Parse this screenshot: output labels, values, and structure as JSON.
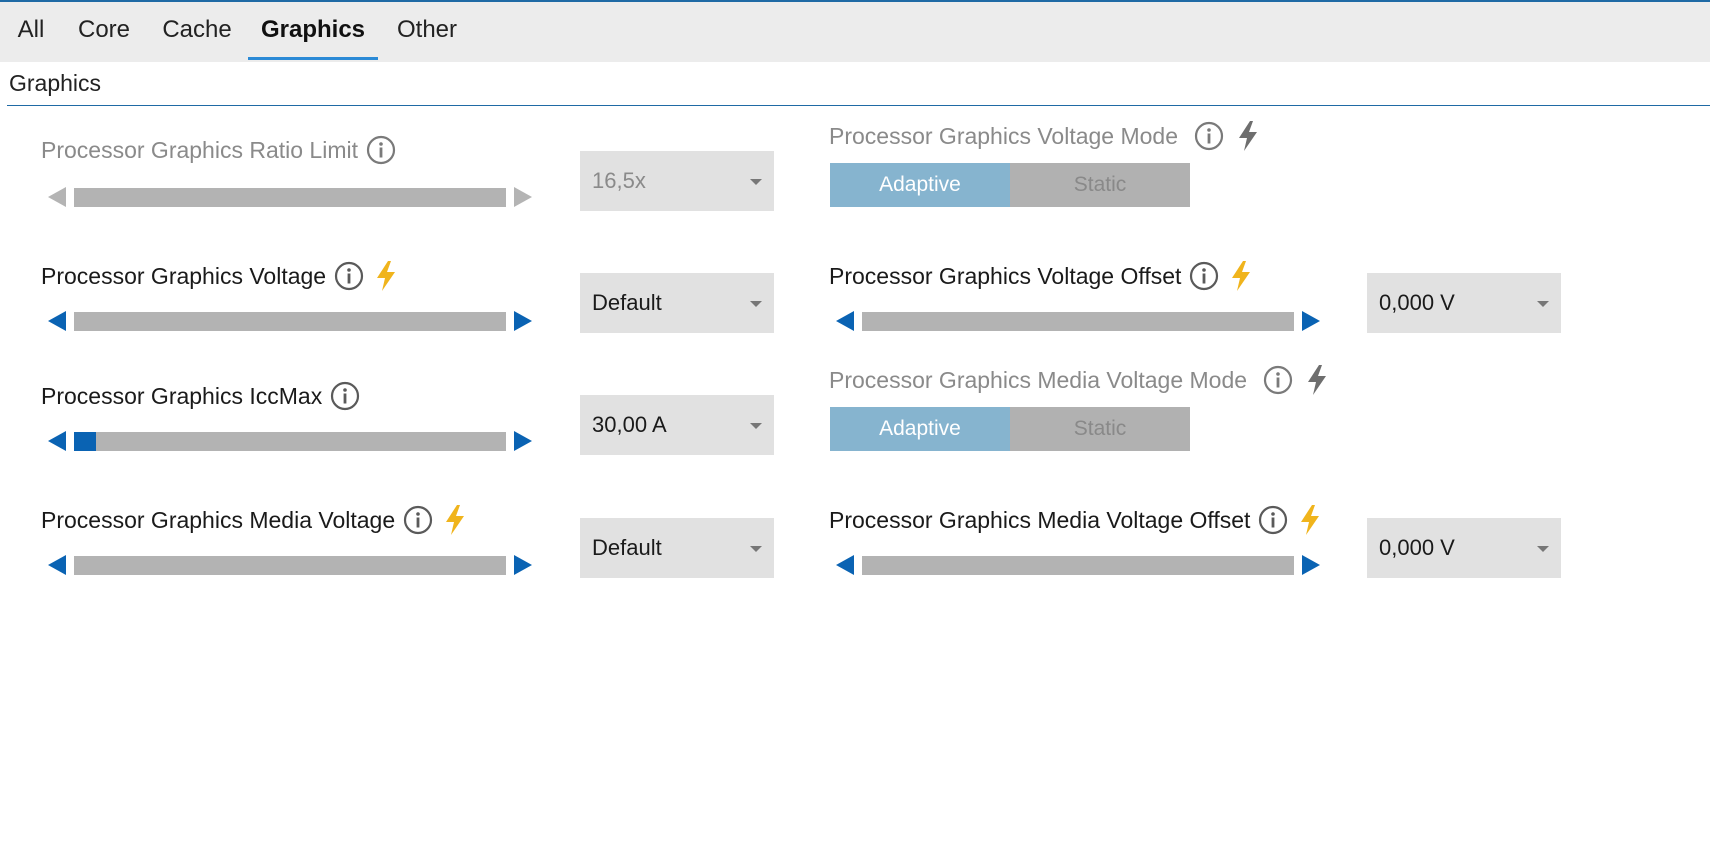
{
  "tabs": [
    {
      "label": "All"
    },
    {
      "label": "Core"
    },
    {
      "label": "Cache"
    },
    {
      "label": "Graphics",
      "active": true
    },
    {
      "label": "Other"
    }
  ],
  "section": {
    "title": "Graphics"
  },
  "settings": {
    "ratio_limit": {
      "label": "Processor Graphics Ratio Limit",
      "value": "16,5x",
      "enabled": false
    },
    "voltage": {
      "label": "Processor Graphics Voltage",
      "value": "Default"
    },
    "iccmax": {
      "label": "Processor Graphics IccMax",
      "value": "30,00 A",
      "slider_fraction": 0.05
    },
    "media_voltage": {
      "label": "Processor Graphics Media Voltage",
      "value": "Default"
    },
    "voltage_mode": {
      "label": "Processor Graphics Voltage Mode",
      "options": [
        "Adaptive",
        "Static"
      ],
      "selected": "Adaptive",
      "enabled": false
    },
    "voltage_offset": {
      "label": "Processor Graphics Voltage Offset",
      "value": "0,000 V"
    },
    "media_voltage_mode": {
      "label": "Processor Graphics Media Voltage Mode",
      "options": [
        "Adaptive",
        "Static"
      ],
      "selected": "Adaptive",
      "enabled": false
    },
    "media_voltage_offset": {
      "label": "Processor Graphics Media Voltage Offset",
      "value": "0,000 V"
    }
  },
  "colors": {
    "accent": "#0a63b3",
    "bolt_active": "#f0b41c",
    "bolt_inactive": "#6e6e6e",
    "tab_underline": "#2b8ad6"
  },
  "icons": {
    "info": "info-circle-icon",
    "bolt": "lightning-bolt-icon"
  }
}
